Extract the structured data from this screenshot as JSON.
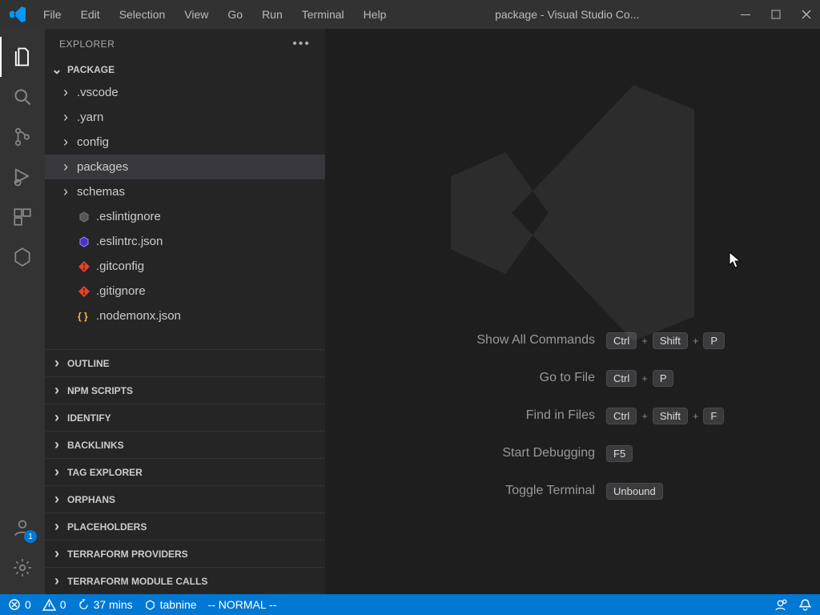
{
  "menu": {
    "items": [
      "File",
      "Edit",
      "Selection",
      "View",
      "Go",
      "Run",
      "Terminal",
      "Help"
    ]
  },
  "window": {
    "title": "package - Visual Studio Co..."
  },
  "activity": {
    "account_badge": "1"
  },
  "side": {
    "header": "EXPLORER",
    "root": "PACKAGE",
    "folders": [
      {
        "name": ".vscode"
      },
      {
        "name": ".yarn"
      },
      {
        "name": "config"
      },
      {
        "name": "packages",
        "selected": true
      },
      {
        "name": "schemas"
      }
    ],
    "files": [
      {
        "name": ".eslintignore",
        "icon": "eslint-dim"
      },
      {
        "name": ".eslintrc.json",
        "icon": "eslint-bright"
      },
      {
        "name": ".gitconfig",
        "icon": "git"
      },
      {
        "name": ".gitignore",
        "icon": "git"
      },
      {
        "name": ".nodemonx.json",
        "icon": "json"
      }
    ],
    "sections": [
      "OUTLINE",
      "NPM SCRIPTS",
      "IDENTIFY",
      "BACKLINKS",
      "TAG EXPLORER",
      "ORPHANS",
      "PLACEHOLDERS",
      "TERRAFORM PROVIDERS",
      "TERRAFORM MODULE CALLS"
    ]
  },
  "welcome": {
    "shortcuts": [
      {
        "label": "Show All Commands",
        "keys": [
          "Ctrl",
          "Shift",
          "P"
        ]
      },
      {
        "label": "Go to File",
        "keys": [
          "Ctrl",
          "P"
        ]
      },
      {
        "label": "Find in Files",
        "keys": [
          "Ctrl",
          "Shift",
          "F"
        ]
      },
      {
        "label": "Start Debugging",
        "keys": [
          "F5"
        ]
      },
      {
        "label": "Toggle Terminal",
        "keys": [
          "Unbound"
        ]
      }
    ]
  },
  "status": {
    "errors": "0",
    "warnings": "0",
    "time": "37 mins",
    "tabnine": "tabnine",
    "mode": "-- NORMAL --"
  }
}
